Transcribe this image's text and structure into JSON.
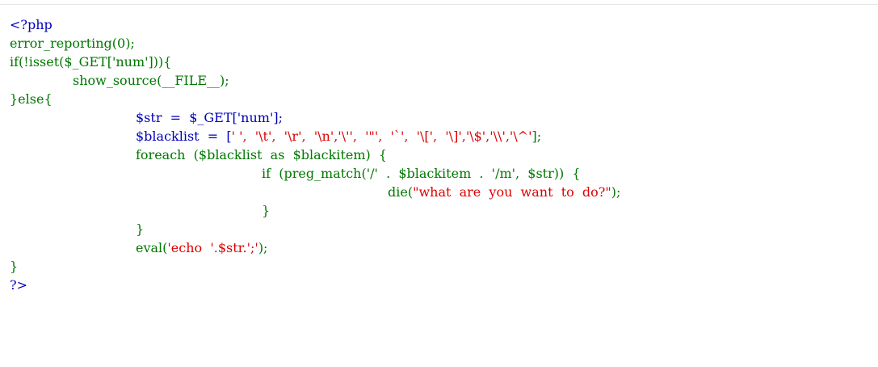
{
  "code": {
    "line1": "<?php",
    "line2": "error_reporting(0);",
    "line3": "if(!isset($_GET['num'])){",
    "line4": "show_source(__FILE__);",
    "line5": "}else{",
    "line6": "$str  =  $_GET['num'];",
    "line7_var": "$blacklist  =  [",
    "line7_strs": "' ',  '\\t',  '\\r',  '\\n','\\'',  '\"',  '`',  '\\[',  '\\]','\\$','\\\\','\\^'",
    "line7_end": "];",
    "line8": "foreach  ($blacklist  as  $blackitem)  {",
    "line9_kw": "if  (preg_match('/'  .  $blackitem  .  '/m',  $str))  {",
    "line10_fn": "die(",
    "line10_str": "\"what  are  you  want  to  do?\"",
    "line10_end": ");",
    "line11": "}",
    "line12": "}",
    "line13_fn": "eval(",
    "line13_str": "'echo  '.$str.';'",
    "line13_end": ");",
    "line14": "}",
    "line15": "?>"
  },
  "colors": {
    "keyword": "#007700",
    "default": "#0000bb",
    "string": "#dd0000"
  }
}
